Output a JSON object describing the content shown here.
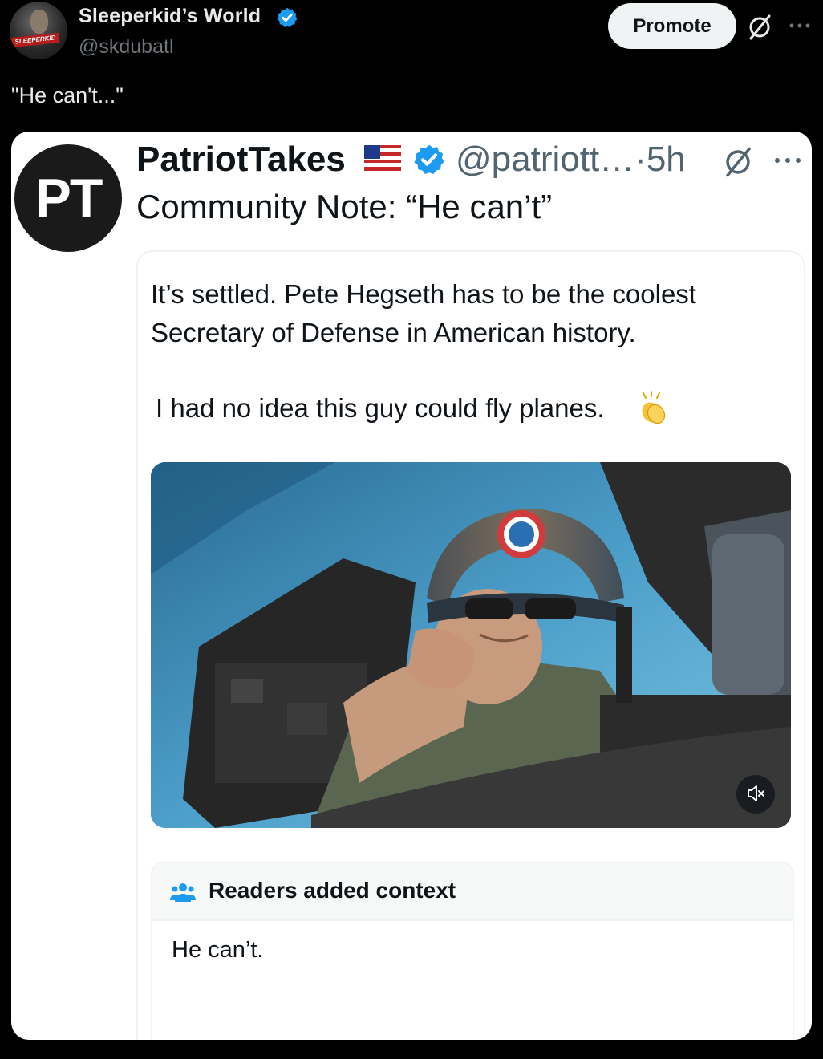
{
  "outer_tweet": {
    "author_name": "Sleeperkid’s World",
    "handle": "@skdubatl",
    "avatar_text": "SLEEPERKID",
    "promote_label": "Promote",
    "text": "\"He can't...\""
  },
  "quoted_tweet": {
    "avatar_text": "PT",
    "author_name": "PatriotTakes",
    "handle_time": "@patriott…·5h",
    "text": "Community Note: “He can’t”"
  },
  "inner_quote": {
    "line1": "It’s settled. Pete Hegseth has to be the coolest",
    "line2": "Secretary of Defense in American history.",
    "line3": "I had no idea this guy could fly planes."
  },
  "community_note": {
    "title": "Readers added context",
    "body": "He can’t."
  },
  "colors": {
    "verified": "#1d9bf0",
    "background": "#000000",
    "card": "#ffffff",
    "muted_text": "#71767b"
  },
  "icons": [
    "verified-badge-icon",
    "grok-icon",
    "more-icon",
    "flag-icon",
    "clap-icon",
    "mute-icon",
    "people-icon"
  ]
}
